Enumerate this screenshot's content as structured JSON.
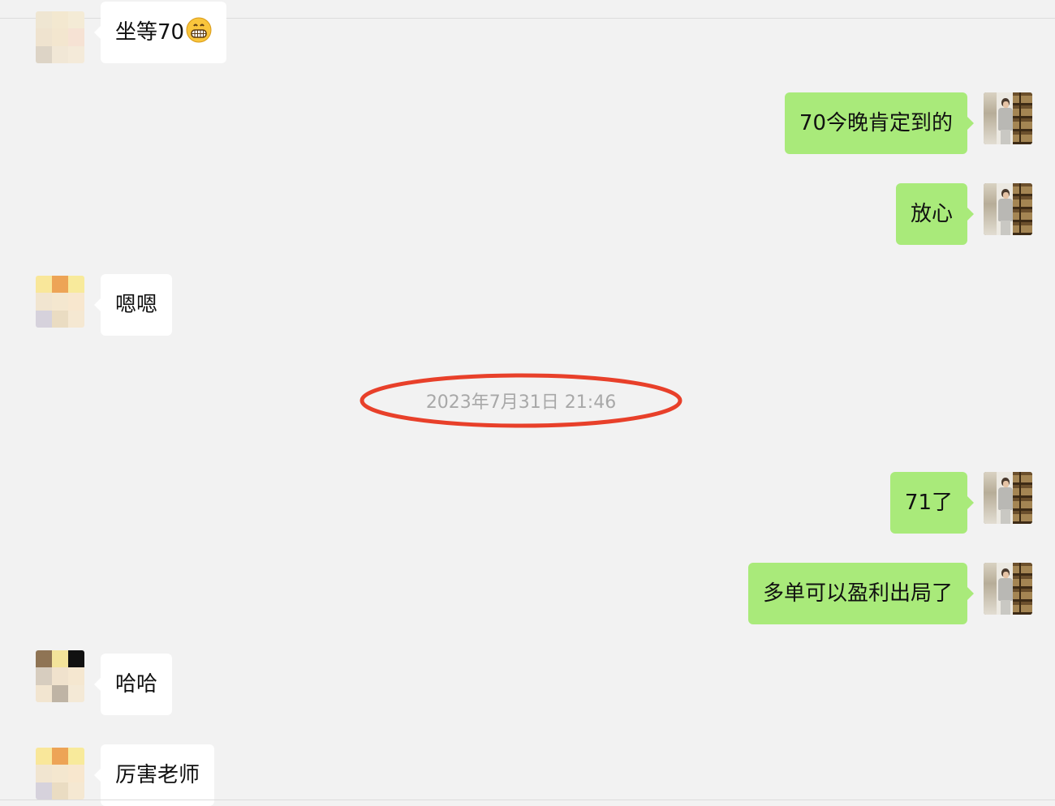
{
  "messages": [
    {
      "side": "left",
      "text": "坐等70",
      "emoji": "grinning-face-icon"
    },
    {
      "side": "right",
      "text": "70今晚肯定到的"
    },
    {
      "side": "right",
      "text": "放心"
    },
    {
      "side": "left",
      "text": "嗯嗯"
    },
    {
      "side": "right",
      "text": "71了"
    },
    {
      "side": "right",
      "text": "多单可以盈利出局了"
    },
    {
      "side": "left",
      "text": "哈哈"
    },
    {
      "side": "left",
      "text": "厉害老师"
    }
  ],
  "timestamp": "2023年7月31日 21:46",
  "colors": {
    "background": "#f2f2f2",
    "outgoing_bubble": "#a9ea7a",
    "incoming_bubble": "#ffffff",
    "highlight_circle": "#e8402a"
  }
}
